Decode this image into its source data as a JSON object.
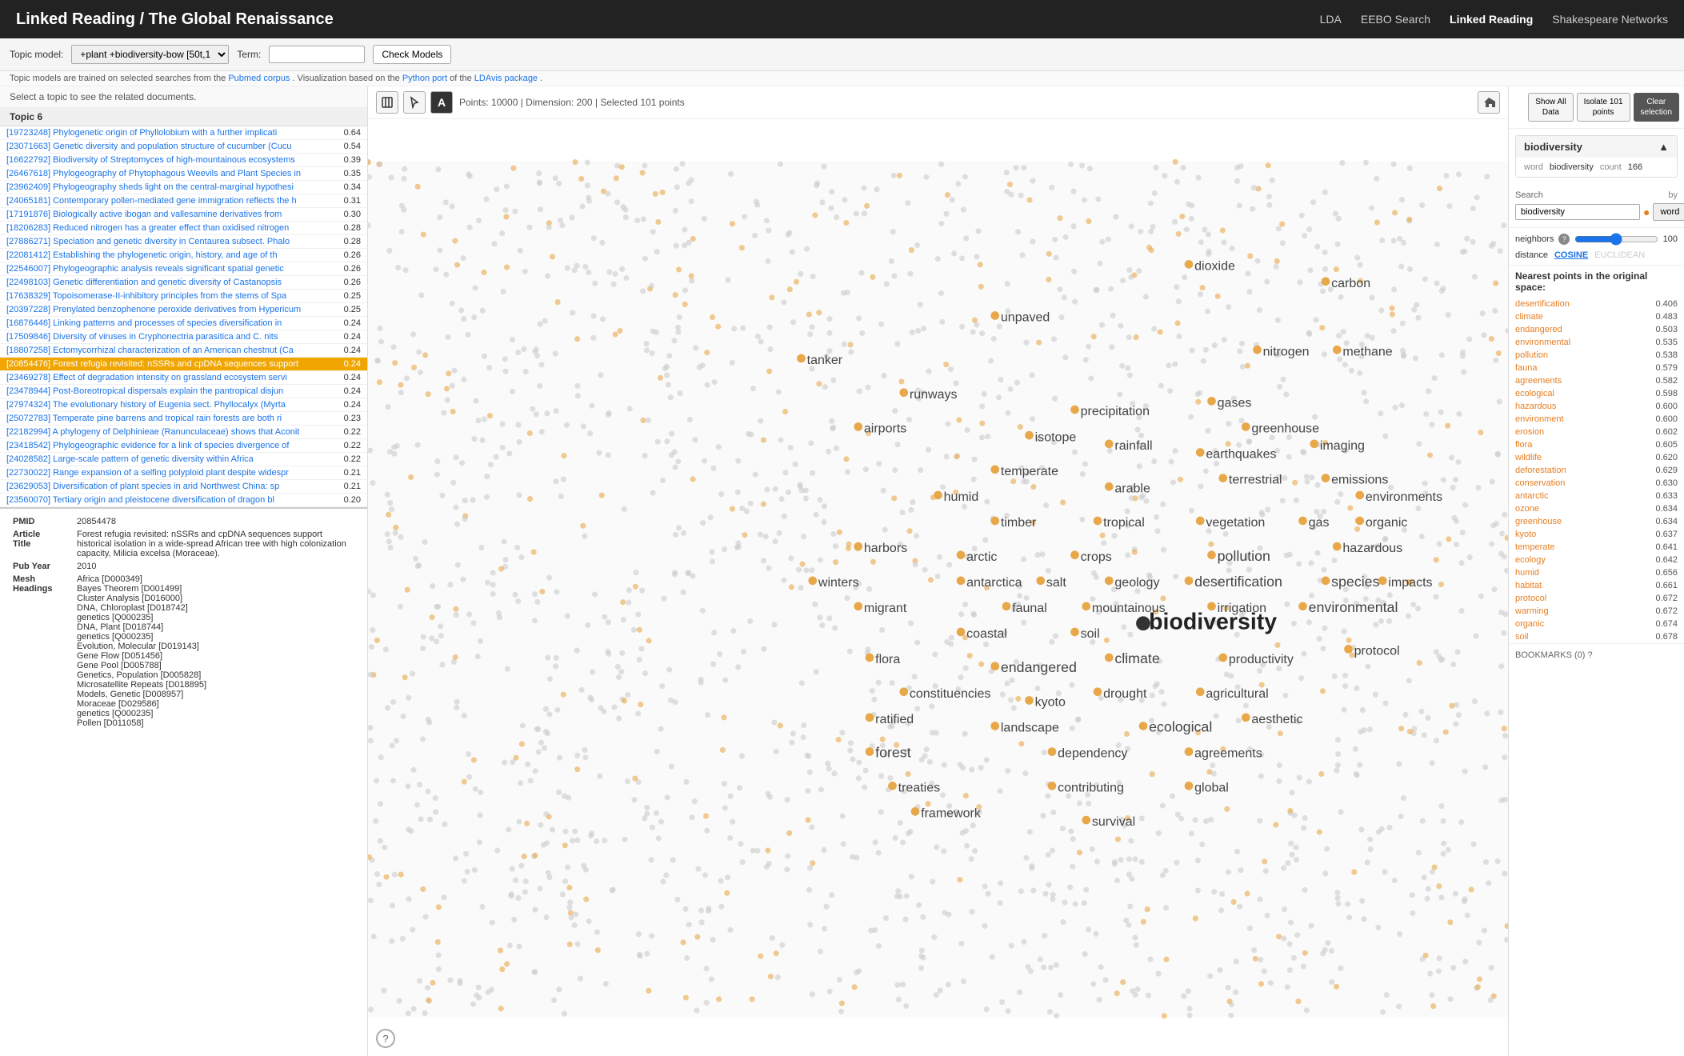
{
  "navbar": {
    "title": "Linked Reading / The Global Renaissance",
    "links": [
      {
        "label": "LDA",
        "active": false
      },
      {
        "label": "EEBO Search",
        "active": false
      },
      {
        "label": "Linked Reading",
        "active": true
      },
      {
        "label": "Shakespeare Networks",
        "active": false
      }
    ]
  },
  "toolbar": {
    "topic_model_label": "Topic model:",
    "topic_model_value": "+plant +biodiversity-bow [50t,1",
    "term_label": "Term:",
    "term_value": "",
    "check_models_btn": "Check Models"
  },
  "subtext": {
    "text": "Topic models are trained on selected searches from the",
    "link1": "Pubmed corpus",
    "mid1": ". Visualization based on the",
    "link2": "Python port",
    "mid2": " of the",
    "link3": "LDAvis package",
    "end": "."
  },
  "left_panel": {
    "header": "Select a topic to see the related documents.",
    "topic_label": "Topic 6",
    "docs": [
      {
        "id": "[19723248]",
        "title": "Phylogenetic origin of Phyllolobium with a further implicati",
        "score": "0.64"
      },
      {
        "id": "[23071663]",
        "title": "Genetic diversity and population structure of cucumber (Cucu",
        "score": "0.54"
      },
      {
        "id": "[16622792]",
        "title": "Biodiversity of Streptomyces of high-mountainous ecosystems",
        "score": "0.39"
      },
      {
        "id": "[26467618]",
        "title": "Phylogeography of Phytophagous Weevils and Plant Species in",
        "score": "0.35"
      },
      {
        "id": "[23962409]",
        "title": "Phylogeography sheds light on the central-marginal hypothesi",
        "score": "0.34"
      },
      {
        "id": "[24065181]",
        "title": "Contemporary pollen-mediated gene immigration reflects the h",
        "score": "0.31"
      },
      {
        "id": "[17191876]",
        "title": "Biologically active ibogan and vallesamine derivatives from",
        "score": "0.30"
      },
      {
        "id": "[18206283]",
        "title": "Reduced nitrogen has a greater effect than oxidised nitrogen",
        "score": "0.28"
      },
      {
        "id": "[27886271]",
        "title": "Speciation and genetic diversity in Centaurea subsect. Phalo",
        "score": "0.28"
      },
      {
        "id": "[22081412]",
        "title": "Establishing the phylogenetic origin, history, and age of th",
        "score": "0.26"
      },
      {
        "id": "[22546007]",
        "title": "Phylogeographic analysis reveals significant spatial genetic",
        "score": "0.26"
      },
      {
        "id": "[22498103]",
        "title": "Genetic differentiation and genetic diversity of Castanopsis",
        "score": "0.26"
      },
      {
        "id": "[17638329]",
        "title": "Topoisomerase-II-inhibitory principles from the stems of Spa",
        "score": "0.25"
      },
      {
        "id": "[20397228]",
        "title": "Prenylated benzophenone peroxide derivatives from Hypericum",
        "score": "0.25"
      },
      {
        "id": "[16876446]",
        "title": "Linking patterns and processes of species diversification in",
        "score": "0.24"
      },
      {
        "id": "[17509846]",
        "title": "Diversity of viruses in Cryphonectria parasitica and C. nits",
        "score": "0.24"
      },
      {
        "id": "[18807258]",
        "title": "Ectomycorrhizal characterization of an American chestnut (Ca",
        "score": "0.24"
      },
      {
        "id": "[20854476]",
        "title": "Forest refugia revisited: nSSRs and cpDNA sequences support",
        "score": "0.24",
        "selected": true
      },
      {
        "id": "[23469278]",
        "title": "Effect of degradation intensity on grassland ecosystem servi",
        "score": "0.24"
      },
      {
        "id": "[23478944]",
        "title": "Post-Boreotropical dispersals explain the pantropical disjun",
        "score": "0.24"
      },
      {
        "id": "[27974324]",
        "title": "The evolutionary history of Eugenia sect. Phyllocalyx (Myrta",
        "score": "0.24"
      },
      {
        "id": "[25072783]",
        "title": "Temperate pine barrens and tropical rain forests are both ri",
        "score": "0.23"
      },
      {
        "id": "[22182994]",
        "title": "A phylogeny of Delphinieae (Ranunculaceae) shows that Aconit",
        "score": "0.22"
      },
      {
        "id": "[23418542]",
        "title": "Phylogeographic evidence for a link of species divergence of",
        "score": "0.22"
      },
      {
        "id": "[24028582]",
        "title": "Large-scale pattern of genetic diversity within Africa",
        "score": "0.22"
      },
      {
        "id": "[22730022]",
        "title": "Range expansion of a selfing polyploid plant despite widespr",
        "score": "0.21"
      },
      {
        "id": "[23629053]",
        "title": "Diversification of plant species in arid Northwest China: sp",
        "score": "0.21"
      },
      {
        "id": "[23560070]",
        "title": "Tertiary origin and pleistocene diversification of dragon bl",
        "score": "0.20"
      }
    ],
    "article": {
      "pmid_label": "PMID",
      "pmid": "20854478",
      "article_title_label": "Article\nTitle",
      "article_title": "Forest refugia revisited: nSSRs and cpDNA sequences support historical isolation in a wide-spread African tree with high colonization capacity, Milicia excelsa (Moraceae).",
      "pub_year_label": "Pub Year",
      "pub_year": "2010",
      "mesh_label": "Mesh\nHeadings",
      "mesh_items": [
        "Africa [D000349]",
        "Bayes Theorem [D001499]",
        "Cluster Analysis [D016000]",
        "DNA, Chloroplast [D018742]",
        "genetics [Q000235]",
        "DNA, Plant [D018744]",
        "genetics [Q000235]",
        "Evolution, Molecular [D019143]",
        "Gene Flow [D051456]",
        "Gene Pool [D005788]",
        "Genetics, Population [D005828]",
        "Microsatellite Repeats [D018895]",
        "Models, Genetic [D008957]",
        "Moraceae [D029586]",
        "genetics [Q000235]",
        "Pollen [D011058]"
      ]
    }
  },
  "map": {
    "icon_move": "⊕",
    "icon_circle": "●",
    "icon_text": "A",
    "stats": "Points: 10000  |  Dimension: 200  |  Selected 101 points",
    "home_icon": "⌂",
    "selected_word": "biodiversity"
  },
  "right_panel": {
    "show_all_btn": "Show All\nData",
    "isolate_btn": "Isolate 101\npoints",
    "clear_btn": "Clear\nselection",
    "word_card": {
      "title": "biodiversity",
      "collapse_icon": "▲",
      "word_label": "word",
      "word_value": "biodiversity",
      "count_label": "count",
      "count_value": "166"
    },
    "search": {
      "label": "Search",
      "by_label": "by",
      "input_value": "biodiversity",
      "by_value": "word"
    },
    "neighbors": {
      "label": "neighbors",
      "value": "100",
      "help": "?"
    },
    "distance": {
      "label": "distance",
      "cosine": "COSINE",
      "euclidean": "EUCLIDEAN"
    },
    "nearest_header": "Nearest points in the original space:",
    "nearest_items": [
      {
        "word": "desertification",
        "score": "0.406"
      },
      {
        "word": "climate",
        "score": "0.483"
      },
      {
        "word": "endangered",
        "score": "0.503"
      },
      {
        "word": "environmental",
        "score": "0.535"
      },
      {
        "word": "pollution",
        "score": "0.538"
      },
      {
        "word": "fauna",
        "score": "0.579"
      },
      {
        "word": "agreements",
        "score": "0.582"
      },
      {
        "word": "ecological",
        "score": "0.598"
      },
      {
        "word": "hazardous",
        "score": "0.600"
      },
      {
        "word": "environment",
        "score": "0.600"
      },
      {
        "word": "erosion",
        "score": "0.602"
      },
      {
        "word": "flora",
        "score": "0.605"
      },
      {
        "word": "wildlife",
        "score": "0.620"
      },
      {
        "word": "deforestation",
        "score": "0.629"
      },
      {
        "word": "conservation",
        "score": "0.630"
      },
      {
        "word": "antarctic",
        "score": "0.633"
      },
      {
        "word": "ozone",
        "score": "0.634"
      },
      {
        "word": "greenhouse",
        "score": "0.634"
      },
      {
        "word": "kyoto",
        "score": "0.637"
      },
      {
        "word": "temperate",
        "score": "0.641"
      },
      {
        "word": "ecology",
        "score": "0.642"
      },
      {
        "word": "humid",
        "score": "0.656"
      },
      {
        "word": "habitat",
        "score": "0.661"
      },
      {
        "word": "protocol",
        "score": "0.672"
      },
      {
        "word": "warming",
        "score": "0.672"
      },
      {
        "word": "organic",
        "score": "0.674"
      },
      {
        "word": "soil",
        "score": "0.678"
      }
    ],
    "bookmarks": "BOOKMARKS (0) ?"
  },
  "scatter": {
    "words": [
      {
        "x": 0.55,
        "y": 0.18,
        "label": "unpaved",
        "size": 9
      },
      {
        "x": 0.72,
        "y": 0.12,
        "label": "dioxide",
        "size": 9
      },
      {
        "x": 0.84,
        "y": 0.14,
        "label": "carbon",
        "size": 9
      },
      {
        "x": 0.38,
        "y": 0.23,
        "label": "tanker",
        "size": 9
      },
      {
        "x": 0.78,
        "y": 0.22,
        "label": "nitrogen",
        "size": 9
      },
      {
        "x": 0.85,
        "y": 0.22,
        "label": "methane",
        "size": 9
      },
      {
        "x": 0.47,
        "y": 0.27,
        "label": "runways",
        "size": 9
      },
      {
        "x": 0.62,
        "y": 0.29,
        "label": "precipitation",
        "size": 9
      },
      {
        "x": 0.74,
        "y": 0.28,
        "label": "gases",
        "size": 9
      },
      {
        "x": 0.58,
        "y": 0.32,
        "label": "isotope",
        "size": 9
      },
      {
        "x": 0.65,
        "y": 0.33,
        "label": "rainfall",
        "size": 9
      },
      {
        "x": 0.77,
        "y": 0.31,
        "label": "greenhouse",
        "size": 9
      },
      {
        "x": 0.43,
        "y": 0.31,
        "label": "airports",
        "size": 9
      },
      {
        "x": 0.55,
        "y": 0.36,
        "label": "temperate",
        "size": 9
      },
      {
        "x": 0.73,
        "y": 0.34,
        "label": "earthquakes",
        "size": 9
      },
      {
        "x": 0.83,
        "y": 0.33,
        "label": "imaging",
        "size": 9
      },
      {
        "x": 0.5,
        "y": 0.39,
        "label": "humid",
        "size": 9
      },
      {
        "x": 0.65,
        "y": 0.38,
        "label": "arable",
        "size": 9
      },
      {
        "x": 0.75,
        "y": 0.37,
        "label": "terrestrial",
        "size": 9
      },
      {
        "x": 0.84,
        "y": 0.37,
        "label": "emissions",
        "size": 9
      },
      {
        "x": 0.87,
        "y": 0.39,
        "label": "environments",
        "size": 9
      },
      {
        "x": 0.55,
        "y": 0.42,
        "label": "timber",
        "size": 9
      },
      {
        "x": 0.64,
        "y": 0.42,
        "label": "tropical",
        "size": 9
      },
      {
        "x": 0.73,
        "y": 0.42,
        "label": "vegetation",
        "size": 9
      },
      {
        "x": 0.82,
        "y": 0.42,
        "label": "gas",
        "size": 9
      },
      {
        "x": 0.87,
        "y": 0.42,
        "label": "organic",
        "size": 9
      },
      {
        "x": 0.43,
        "y": 0.45,
        "label": "harbors",
        "size": 9
      },
      {
        "x": 0.52,
        "y": 0.46,
        "label": "arctic",
        "size": 9
      },
      {
        "x": 0.62,
        "y": 0.46,
        "label": "crops",
        "size": 9
      },
      {
        "x": 0.74,
        "y": 0.46,
        "label": "pollution",
        "size": 10
      },
      {
        "x": 0.85,
        "y": 0.45,
        "label": "hazardous",
        "size": 9
      },
      {
        "x": 0.39,
        "y": 0.49,
        "label": "winters",
        "size": 9
      },
      {
        "x": 0.52,
        "y": 0.49,
        "label": "antarctica",
        "size": 9
      },
      {
        "x": 0.59,
        "y": 0.49,
        "label": "salt",
        "size": 9
      },
      {
        "x": 0.65,
        "y": 0.49,
        "label": "geology",
        "size": 9
      },
      {
        "x": 0.72,
        "y": 0.49,
        "label": "desertification",
        "size": 10
      },
      {
        "x": 0.84,
        "y": 0.49,
        "label": "species",
        "size": 10
      },
      {
        "x": 0.89,
        "y": 0.49,
        "label": "impacts",
        "size": 9
      },
      {
        "x": 0.43,
        "y": 0.52,
        "label": "migrant",
        "size": 9
      },
      {
        "x": 0.56,
        "y": 0.52,
        "label": "faunal",
        "size": 9
      },
      {
        "x": 0.63,
        "y": 0.52,
        "label": "mountainous",
        "size": 9
      },
      {
        "x": 0.74,
        "y": 0.52,
        "label": "irrigation",
        "size": 9
      },
      {
        "x": 0.82,
        "y": 0.52,
        "label": "environmental",
        "size": 10
      },
      {
        "x": 0.68,
        "y": 0.54,
        "label": "biodiversity",
        "size": 16,
        "bold": true
      },
      {
        "x": 0.52,
        "y": 0.55,
        "label": "coastal",
        "size": 9
      },
      {
        "x": 0.62,
        "y": 0.55,
        "label": "soil",
        "size": 9
      },
      {
        "x": 0.44,
        "y": 0.58,
        "label": "flora",
        "size": 9
      },
      {
        "x": 0.55,
        "y": 0.59,
        "label": "endangered",
        "size": 10
      },
      {
        "x": 0.65,
        "y": 0.58,
        "label": "climate",
        "size": 10
      },
      {
        "x": 0.75,
        "y": 0.58,
        "label": "productivity",
        "size": 9
      },
      {
        "x": 0.86,
        "y": 0.57,
        "label": "protocol",
        "size": 9
      },
      {
        "x": 0.47,
        "y": 0.62,
        "label": "constituencies",
        "size": 9
      },
      {
        "x": 0.58,
        "y": 0.63,
        "label": "kyoto",
        "size": 9
      },
      {
        "x": 0.64,
        "y": 0.62,
        "label": "drought",
        "size": 9
      },
      {
        "x": 0.73,
        "y": 0.62,
        "label": "agricultural",
        "size": 9
      },
      {
        "x": 0.44,
        "y": 0.65,
        "label": "ratified",
        "size": 9
      },
      {
        "x": 0.55,
        "y": 0.66,
        "label": "landscape",
        "size": 9
      },
      {
        "x": 0.68,
        "y": 0.66,
        "label": "ecological",
        "size": 10
      },
      {
        "x": 0.77,
        "y": 0.65,
        "label": "aesthetic",
        "size": 9
      },
      {
        "x": 0.44,
        "y": 0.69,
        "label": "forest",
        "size": 10
      },
      {
        "x": 0.6,
        "y": 0.69,
        "label": "dependency",
        "size": 9
      },
      {
        "x": 0.72,
        "y": 0.69,
        "label": "agreements",
        "size": 9
      },
      {
        "x": 0.46,
        "y": 0.73,
        "label": "treaties",
        "size": 9
      },
      {
        "x": 0.6,
        "y": 0.73,
        "label": "contributing",
        "size": 9
      },
      {
        "x": 0.72,
        "y": 0.73,
        "label": "global",
        "size": 9
      },
      {
        "x": 0.48,
        "y": 0.76,
        "label": "framework",
        "size": 9
      },
      {
        "x": 0.63,
        "y": 0.77,
        "label": "survival",
        "size": 9
      }
    ]
  }
}
